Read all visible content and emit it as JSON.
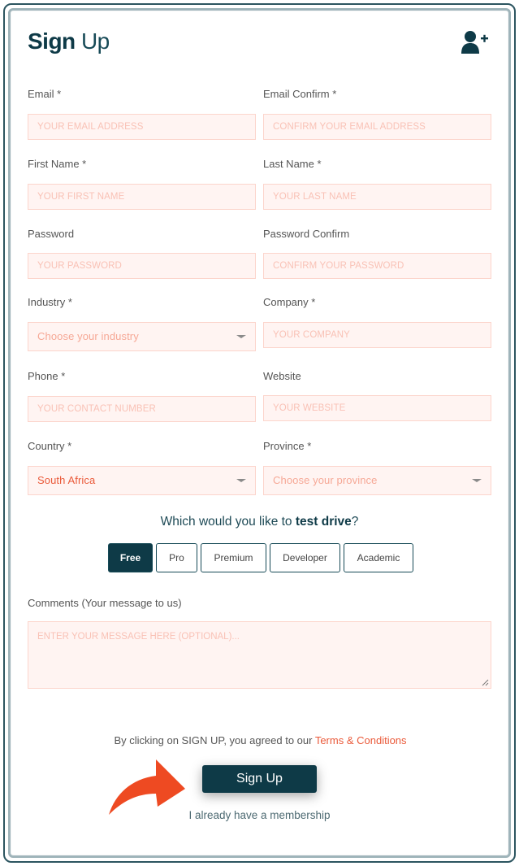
{
  "header": {
    "title_bold": "Sign",
    "title_light": "Up",
    "icon": "user-plus-icon"
  },
  "fields": {
    "email": {
      "label": "Email *",
      "placeholder": "YOUR EMAIL ADDRESS",
      "value": ""
    },
    "email_confirm": {
      "label": "Email Confirm *",
      "placeholder": "CONFIRM YOUR EMAIL ADDRESS",
      "value": ""
    },
    "first_name": {
      "label": "First Name *",
      "placeholder": "YOUR FIRST NAME",
      "value": ""
    },
    "last_name": {
      "label": "Last Name *",
      "placeholder": "YOUR LAST NAME",
      "value": ""
    },
    "password": {
      "label": "Password",
      "placeholder": "YOUR PASSWORD",
      "value": ""
    },
    "password_confirm": {
      "label": "Password Confirm",
      "placeholder": "CONFIRM YOUR PASSWORD",
      "value": ""
    },
    "industry": {
      "label": "Industry *",
      "selected": "Choose your industry"
    },
    "company": {
      "label": "Company *",
      "placeholder": "YOUR COMPANY",
      "value": ""
    },
    "phone": {
      "label": "Phone *",
      "placeholder": "YOUR CONTACT NUMBER",
      "value": ""
    },
    "website": {
      "label": "Website",
      "placeholder": "YOUR WEBSITE",
      "value": ""
    },
    "country": {
      "label": "Country *",
      "selected": "South Africa"
    },
    "province": {
      "label": "Province *",
      "selected": "Choose your province"
    }
  },
  "test_drive": {
    "question_prefix": "Which would you like to ",
    "question_bold": "test drive",
    "question_suffix": "?",
    "plans": [
      {
        "label": "Free",
        "active": true
      },
      {
        "label": "Pro",
        "active": false
      },
      {
        "label": "Premium",
        "active": false
      },
      {
        "label": "Developer",
        "active": false
      },
      {
        "label": "Academic",
        "active": false
      }
    ]
  },
  "comments": {
    "label": "Comments (Your message to us)",
    "placeholder": "ENTER YOUR MESSAGE HERE (OPTIONAL)..."
  },
  "footer": {
    "terms_prefix": "By clicking on SIGN UP, you agreed to our ",
    "terms_link": "Terms & Conditions",
    "signup_button": "Sign Up",
    "member_link": "I already have a membership"
  },
  "colors": {
    "brand_dark": "#0e3a47",
    "accent_orange": "#ea5a3a",
    "field_bg": "#fff4f2",
    "field_border": "#fcd5cc"
  }
}
